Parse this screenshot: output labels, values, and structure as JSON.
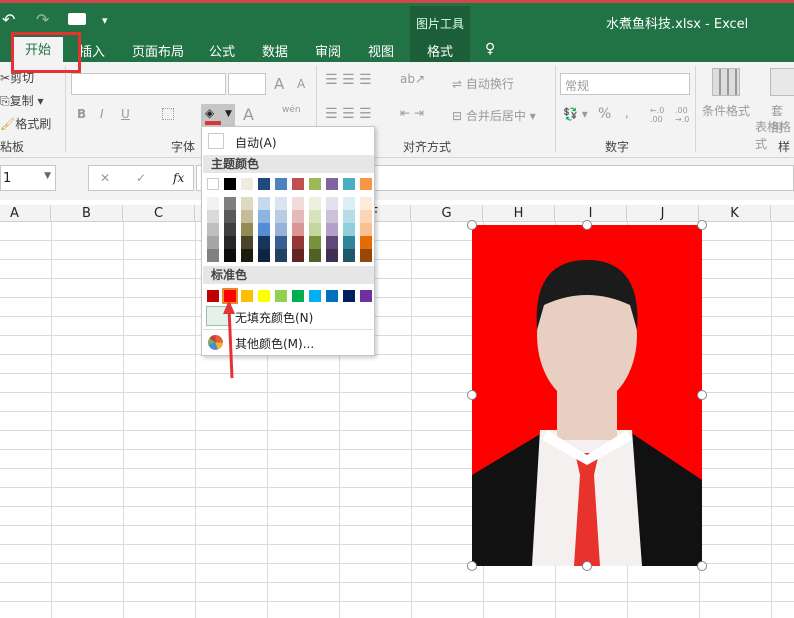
{
  "window": {
    "title": "水煮鱼科技.xlsx - Excel",
    "context_tab_group": "图片工具"
  },
  "qat": {
    "undo": "↶",
    "redo": "↷",
    "camera": "📷",
    "customize": "▾"
  },
  "tabs": [
    {
      "label": "开始",
      "active": true
    },
    {
      "label": "插入"
    },
    {
      "label": "页面布局"
    },
    {
      "label": "公式"
    },
    {
      "label": "数据"
    },
    {
      "label": "审阅"
    },
    {
      "label": "视图"
    },
    {
      "label": "格式"
    }
  ],
  "tell_me_icon": "lightbulb-icon",
  "clipboard": {
    "cut": "剪切",
    "copy": "复制",
    "format_painter": "格式刷",
    "group": "粘板"
  },
  "font": {
    "group": "字体",
    "bold": "B",
    "italic": "I",
    "underline": "U",
    "grow": "A",
    "shrink": "A",
    "font_color": "A",
    "phonetic": "wén"
  },
  "alignment": {
    "wrap": "自动换行",
    "merge": "合并后居中",
    "group": "对齐方式"
  },
  "number": {
    "format": "常规",
    "group": "数字",
    "percent": "%",
    "comma": ",",
    "inc_dec": "←.0 .00",
    "dec_dec": ".00 →.0"
  },
  "styles": {
    "conditional": "条件格式",
    "table_format_1": "套用",
    "table_format_2": "表格格式",
    "group": "样式"
  },
  "formula_bar": {
    "name_box": "1",
    "cancel": "✕",
    "enter": "✓",
    "fx": "fx",
    "value": ""
  },
  "columns": [
    "A",
    "B",
    "C",
    "D",
    "E",
    "F",
    "G",
    "H",
    "I",
    "J",
    "K"
  ],
  "fill_menu": {
    "auto": "自动(A)",
    "theme_header": "主题颜色",
    "theme_top": [
      "#ffffff",
      "#000000",
      "#eeece1",
      "#1f497d",
      "#4f81bd",
      "#c0504d",
      "#9bbb59",
      "#8064a2",
      "#4bacc6",
      "#f79646"
    ],
    "theme_shades": [
      [
        "#f2f2f2",
        "#d9d9d9",
        "#bfbfbf",
        "#a6a6a6",
        "#808080"
      ],
      [
        "#7f7f7f",
        "#595959",
        "#3f3f3f",
        "#262626",
        "#0d0d0d"
      ],
      [
        "#ddd9c3",
        "#c4bd97",
        "#948a54",
        "#4a452a",
        "#1d1b10"
      ],
      [
        "#c6d9f0",
        "#8db3e2",
        "#548dd4",
        "#17365d",
        "#0f243e"
      ],
      [
        "#dbe5f1",
        "#b8cce4",
        "#95b3d7",
        "#366092",
        "#244061"
      ],
      [
        "#f2dcdb",
        "#e5b9b7",
        "#d99694",
        "#953734",
        "#632423"
      ],
      [
        "#ebf1dd",
        "#d7e3bc",
        "#c3d69b",
        "#76923c",
        "#4f6128"
      ],
      [
        "#e5e0ec",
        "#ccc1d9",
        "#b2a2c7",
        "#5f497a",
        "#3f3151"
      ],
      [
        "#dbeef3",
        "#b7dde8",
        "#92cddc",
        "#31859b",
        "#205867"
      ],
      [
        "#fdeada",
        "#fbd5b5",
        "#fac08f",
        "#e36c09",
        "#974806"
      ]
    ],
    "standard_header": "标准色",
    "standard": [
      "#c00000",
      "#ff0000",
      "#ffc000",
      "#ffff00",
      "#92d050",
      "#00b050",
      "#00b0f0",
      "#0070c0",
      "#002060",
      "#7030a0"
    ],
    "selected_standard": "#ff0000",
    "no_fill": "无填充颜色(N)",
    "more": "其他颜色(M)..."
  },
  "picture": {
    "background": "#ff0000",
    "tie": "#e8322c"
  },
  "accent": "#217346",
  "highlight": "#e53333"
}
